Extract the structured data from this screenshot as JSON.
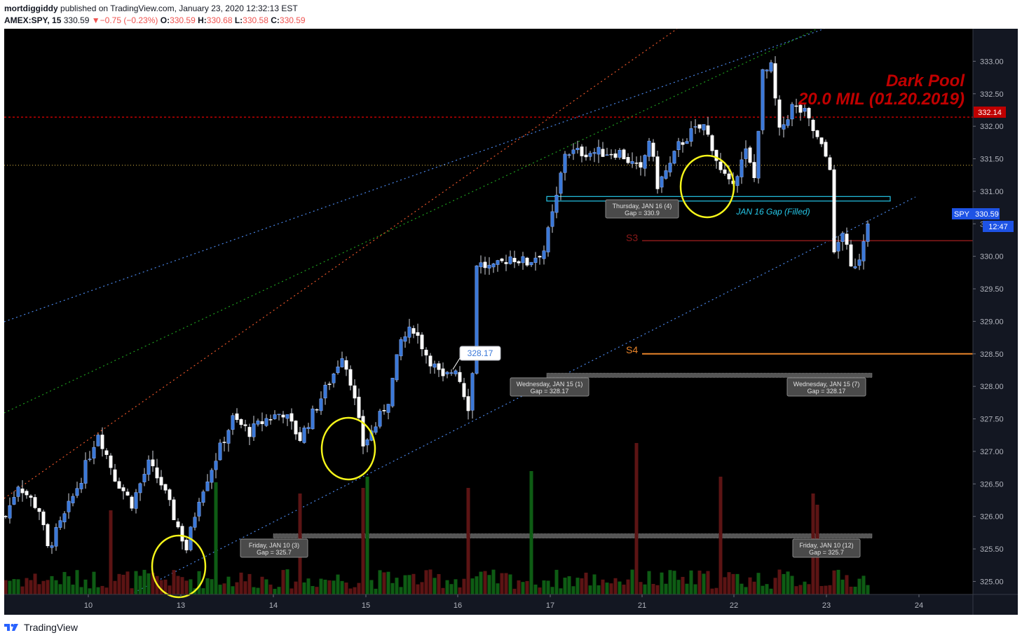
{
  "header": {
    "author": "mortdiggiddy",
    "published_text": "published on TradingView.com, January 23, 2020 12:32:13 EST",
    "symbol": "AMEX:SPY, 15",
    "last": "330.59",
    "change_arrow": "▼",
    "change": "−0.75 (−0.23%)",
    "o_label": "O:",
    "o_value": "330.59",
    "h_label": "H:",
    "h_value": "330.68",
    "l_label": "L:",
    "l_value": "330.58",
    "c_label": "C:",
    "c_value": "330.59"
  },
  "footer": {
    "brand": "TradingView",
    "logo_icon": "tradingview-logo-icon"
  },
  "colors": {
    "up": "#3a78d8",
    "down": "#ffffff",
    "vol_up": "#0e5c14",
    "vol_down": "#5c1414",
    "grid_bg": "#000000",
    "axis_text": "#b2b5be",
    "darkpool": "#c00000",
    "channel_blue": "#4a86e8",
    "channel_green": "#1f9e1f",
    "channel_red": "#e8552a",
    "s3": "#8b1a1a",
    "s4": "#e8842a",
    "gap_box": "#25c7e8",
    "circle": "#f5f51a"
  },
  "chart_data": {
    "type": "candlestick",
    "symbol": "SPY",
    "interval": "15",
    "ylim": [
      324.8,
      333.5
    ],
    "y_ticks": [
      "333.00",
      "332.50",
      "332.00",
      "331.50",
      "331.00",
      "330.50",
      "330.00",
      "329.50",
      "329.00",
      "328.50",
      "328.00",
      "327.50",
      "327.00",
      "326.50",
      "326.00",
      "325.50",
      "325.00"
    ],
    "x_ticks": [
      "10",
      "13",
      "14",
      "15",
      "16",
      "17",
      "21",
      "22",
      "23",
      "24"
    ],
    "last_price_label": "SPY",
    "last_price": "330.59",
    "countdown": "12:47",
    "darkpool_level": 332.14,
    "darkpool_level_label": "332.14",
    "darkpool_title": "Dark Pool",
    "darkpool_subtitle": "20.0 MIL (01.20.2019)",
    "dotted_level": 331.4,
    "s3_label": "S3",
    "s3_level": 330.24,
    "s4_label": "S4",
    "s4_level": 328.5,
    "gap_filled_label": "JAN 16 Gap (Filled)",
    "gap_box": [
      330.85,
      330.92
    ],
    "callout_value": "328.17",
    "gap_annotations": [
      {
        "day": "Wednesday, JAN 15 (1)",
        "gap": "Gap = 328.17"
      },
      {
        "day": "Wednesday, JAN 15 (7)",
        "gap": "Gap = 328.17"
      },
      {
        "day": "Friday, JAN 10 (3)",
        "gap": "Gap = 325.7"
      },
      {
        "day": "Friday, JAN 10 (12)",
        "gap": "Gap = 325.7"
      },
      {
        "day": "Thursday, JAN 16 (4)",
        "gap": "Gap = 330.9"
      }
    ],
    "gap_level_1": 328.17,
    "gap_level_2": 325.7,
    "anchors": [
      [
        0,
        326.0
      ],
      [
        3,
        326.5
      ],
      [
        8,
        326.1
      ],
      [
        10,
        325.5
      ],
      [
        14,
        326.0
      ],
      [
        18,
        326.6
      ],
      [
        22,
        327.3
      ],
      [
        26,
        326.6
      ],
      [
        30,
        326.2
      ],
      [
        34,
        326.8
      ],
      [
        37,
        326.5
      ],
      [
        40,
        326.0
      ],
      [
        43,
        325.5
      ],
      [
        46,
        326.3
      ],
      [
        50,
        326.9
      ],
      [
        54,
        327.5
      ],
      [
        58,
        327.3
      ],
      [
        62,
        327.5
      ],
      [
        66,
        327.6
      ],
      [
        70,
        327.2
      ],
      [
        74,
        327.7
      ],
      [
        78,
        328.2
      ],
      [
        80,
        328.5
      ],
      [
        82,
        328.1
      ],
      [
        85,
        327.1
      ],
      [
        88,
        327.4
      ],
      [
        91,
        327.8
      ],
      [
        94,
        328.7
      ],
      [
        97,
        328.9
      ],
      [
        100,
        328.5
      ],
      [
        104,
        328.1
      ],
      [
        107,
        328.3
      ],
      [
        110,
        327.7
      ],
      [
        111,
        328.2
      ],
      [
        112,
        329.9
      ],
      [
        116,
        329.8
      ],
      [
        120,
        330.0
      ],
      [
        124,
        329.9
      ],
      [
        128,
        330.1
      ],
      [
        131,
        330.9
      ],
      [
        133,
        331.6
      ],
      [
        140,
        331.6
      ],
      [
        146,
        331.6
      ],
      [
        151,
        331.3
      ],
      [
        153,
        331.8
      ],
      [
        155,
        331.1
      ],
      [
        158,
        331.4
      ],
      [
        160,
        331.7
      ],
      [
        163,
        331.9
      ],
      [
        166,
        332.0
      ],
      [
        168,
        331.7
      ],
      [
        170,
        331.3
      ],
      [
        172,
        331.1
      ],
      [
        174,
        331.3
      ],
      [
        176,
        331.6
      ],
      [
        178,
        331.2
      ],
      [
        180,
        332.8
      ],
      [
        182,
        332.9
      ],
      [
        184,
        331.9
      ],
      [
        187,
        332.3
      ],
      [
        190,
        332.2
      ],
      [
        193,
        331.8
      ],
      [
        196,
        331.4
      ],
      [
        197,
        330.0
      ],
      [
        199,
        330.4
      ],
      [
        201,
        329.8
      ],
      [
        203,
        330.0
      ],
      [
        205,
        330.59
      ]
    ],
    "volume_spikes": [
      [
        25,
        1.0
      ],
      [
        50,
        1.5
      ],
      [
        70,
        1.3
      ],
      [
        85,
        1.4
      ],
      [
        86,
        1.6
      ],
      [
        110,
        1.4
      ],
      [
        125,
        1.7
      ],
      [
        150,
        2.2
      ],
      [
        170,
        1.6
      ],
      [
        192,
        1.3
      ],
      [
        193,
        1.1
      ]
    ]
  }
}
